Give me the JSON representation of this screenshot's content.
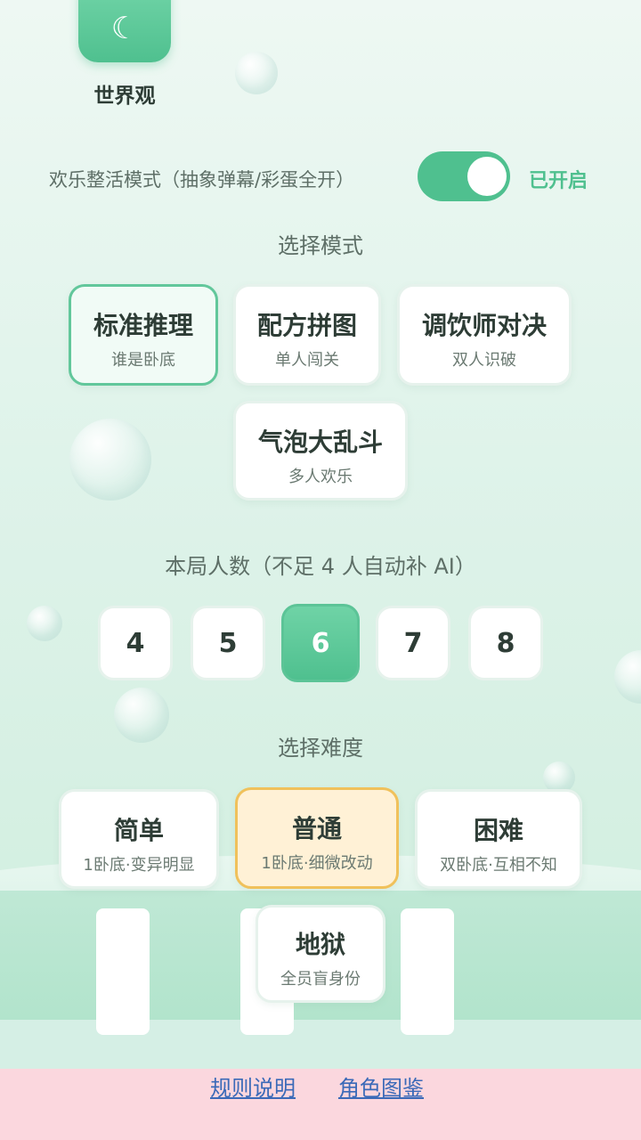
{
  "header": {
    "world_label": "世界观",
    "world_icon": "moon-icon"
  },
  "fun_mode": {
    "label": "欢乐整活模式（抽象弹幕/彩蛋全开）",
    "state": "已开启",
    "enabled": true
  },
  "mode_section": {
    "title": "选择模式",
    "modes": [
      {
        "title": "标准推理",
        "subtitle": "谁是卧底",
        "selected": true
      },
      {
        "title": "配方拼图",
        "subtitle": "单人闯关",
        "selected": false
      },
      {
        "title": "调饮师对决",
        "subtitle": "双人识破",
        "selected": false
      },
      {
        "title": "气泡大乱斗",
        "subtitle": "多人欢乐",
        "selected": false
      }
    ]
  },
  "players_section": {
    "title": "本局人数（不足 4 人自动补 AI）",
    "options": [
      "4",
      "5",
      "6",
      "7",
      "8"
    ],
    "selected": "6"
  },
  "difficulty_section": {
    "title": "选择难度",
    "levels": [
      {
        "title": "简单",
        "subtitle": "1卧底·变异明显",
        "selected": false
      },
      {
        "title": "普通",
        "subtitle": "1卧底·细微改动",
        "selected": true
      },
      {
        "title": "困难",
        "subtitle": "双卧底·互相不知",
        "selected": false
      },
      {
        "title": "地狱",
        "subtitle": "全员盲身份",
        "selected": false
      }
    ]
  },
  "footer": {
    "rules_link": "规则说明",
    "roles_link": "角色图鉴"
  },
  "colors": {
    "accent": "#4fc08f",
    "gold": "#f0c15b",
    "link": "#3b6ab8",
    "pink": "#fbd7de"
  }
}
